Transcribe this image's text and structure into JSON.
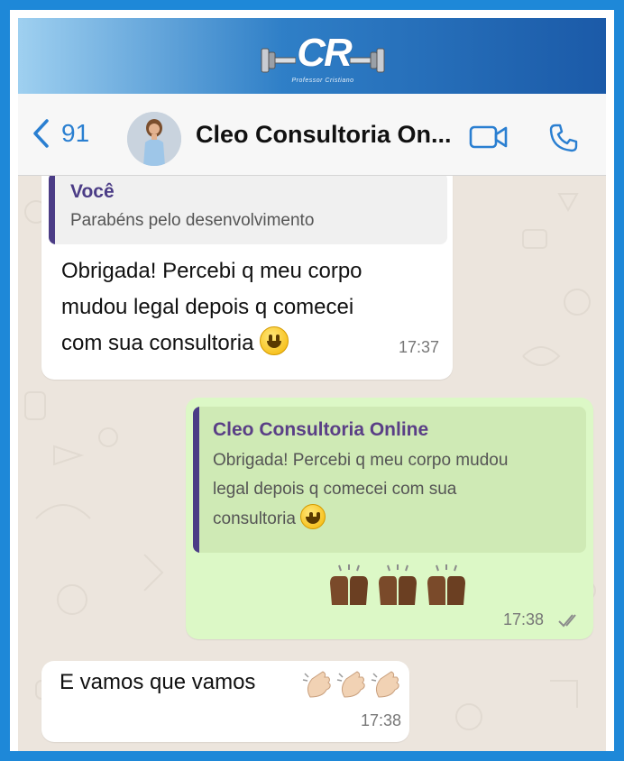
{
  "brand": {
    "logo_text": "CR",
    "logo_subtitle": "Professor Cristiano"
  },
  "header": {
    "back_count": "91",
    "contact_name": "Cleo Consultoria On...",
    "icons": [
      "chevron-left-icon",
      "video-camera-icon",
      "phone-icon"
    ],
    "accent_color": "#2a7fd1"
  },
  "messages": [
    {
      "direction": "incoming",
      "quote": {
        "author": "Você",
        "text": "Parabéns pelo desenvolvimento"
      },
      "lines": [
        "Obrigada! Percebi q meu corpo",
        "mudou legal depois q comecei",
        "com sua consultoria"
      ],
      "emoji": "grinning-face",
      "time": "17:37"
    },
    {
      "direction": "outgoing",
      "quote": {
        "author": "Cleo Consultoria Online",
        "lines": [
          "Obrigada! Percebi q meu corpo mudou",
          "legal depois q comecei com sua",
          "consultoria"
        ],
        "emoji": "grinning-face"
      },
      "emojis": [
        "raising-hands",
        "raising-hands",
        "raising-hands"
      ],
      "time": "17:38",
      "status": "read-double-check"
    },
    {
      "direction": "incoming",
      "text": "E vamos que vamos",
      "emojis": [
        "clapping-hands",
        "clapping-hands",
        "clapping-hands"
      ],
      "time": "17:38"
    }
  ],
  "colors": {
    "frame_border": "#1e88d8",
    "chat_background": "#ece5dd",
    "outgoing_bubble": "#dcf8c6",
    "incoming_bubble": "#ffffff",
    "quote_bar": "#4b3c86"
  }
}
